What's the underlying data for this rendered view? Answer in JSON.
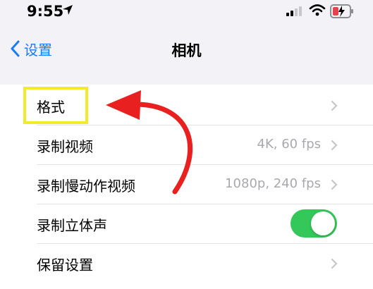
{
  "status_bar": {
    "time": "9:55",
    "location_icon": "location-arrow-icon",
    "signal_icon": "cellular-signal-icon",
    "wifi_icon": "wifi-icon",
    "battery_icon": "battery-charging-icon",
    "battery_color": "#e8414b"
  },
  "nav": {
    "back_label": "设置",
    "title": "相机",
    "accent_color": "#1a7cf5"
  },
  "rows": [
    {
      "label": "格式",
      "value": "",
      "chevron": true
    },
    {
      "label": "录制视频",
      "value": "4K, 60 fps",
      "chevron": true
    },
    {
      "label": "录制慢动作视频",
      "value": "1080p, 240 fps",
      "chevron": true
    },
    {
      "label": "录制立体声",
      "value": "",
      "toggle": true,
      "toggle_on": true
    },
    {
      "label": "保留设置",
      "value": "",
      "chevron": true
    }
  ],
  "annotation": {
    "highlight_color": "#f2ea2a",
    "arrow_color": "#e8201f"
  }
}
